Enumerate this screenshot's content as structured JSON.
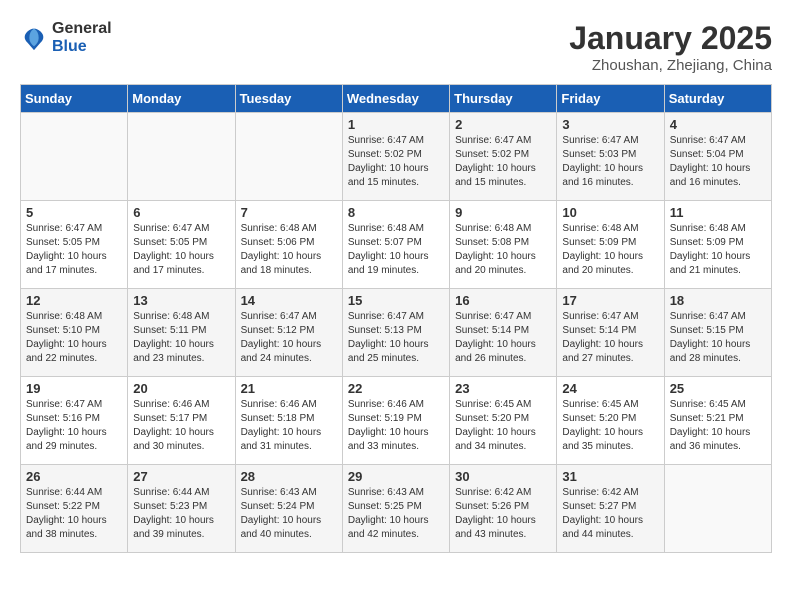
{
  "header": {
    "logo_line1": "General",
    "logo_line2": "Blue",
    "month": "January 2025",
    "location": "Zhoushan, Zhejiang, China"
  },
  "weekdays": [
    "Sunday",
    "Monday",
    "Tuesday",
    "Wednesday",
    "Thursday",
    "Friday",
    "Saturday"
  ],
  "weeks": [
    [
      {
        "day": "",
        "sunrise": "",
        "sunset": "",
        "daylight": ""
      },
      {
        "day": "",
        "sunrise": "",
        "sunset": "",
        "daylight": ""
      },
      {
        "day": "",
        "sunrise": "",
        "sunset": "",
        "daylight": ""
      },
      {
        "day": "1",
        "sunrise": "Sunrise: 6:47 AM",
        "sunset": "Sunset: 5:02 PM",
        "daylight": "Daylight: 10 hours and 15 minutes."
      },
      {
        "day": "2",
        "sunrise": "Sunrise: 6:47 AM",
        "sunset": "Sunset: 5:02 PM",
        "daylight": "Daylight: 10 hours and 15 minutes."
      },
      {
        "day": "3",
        "sunrise": "Sunrise: 6:47 AM",
        "sunset": "Sunset: 5:03 PM",
        "daylight": "Daylight: 10 hours and 16 minutes."
      },
      {
        "day": "4",
        "sunrise": "Sunrise: 6:47 AM",
        "sunset": "Sunset: 5:04 PM",
        "daylight": "Daylight: 10 hours and 16 minutes."
      }
    ],
    [
      {
        "day": "5",
        "sunrise": "Sunrise: 6:47 AM",
        "sunset": "Sunset: 5:05 PM",
        "daylight": "Daylight: 10 hours and 17 minutes."
      },
      {
        "day": "6",
        "sunrise": "Sunrise: 6:47 AM",
        "sunset": "Sunset: 5:05 PM",
        "daylight": "Daylight: 10 hours and 17 minutes."
      },
      {
        "day": "7",
        "sunrise": "Sunrise: 6:48 AM",
        "sunset": "Sunset: 5:06 PM",
        "daylight": "Daylight: 10 hours and 18 minutes."
      },
      {
        "day": "8",
        "sunrise": "Sunrise: 6:48 AM",
        "sunset": "Sunset: 5:07 PM",
        "daylight": "Daylight: 10 hours and 19 minutes."
      },
      {
        "day": "9",
        "sunrise": "Sunrise: 6:48 AM",
        "sunset": "Sunset: 5:08 PM",
        "daylight": "Daylight: 10 hours and 20 minutes."
      },
      {
        "day": "10",
        "sunrise": "Sunrise: 6:48 AM",
        "sunset": "Sunset: 5:09 PM",
        "daylight": "Daylight: 10 hours and 20 minutes."
      },
      {
        "day": "11",
        "sunrise": "Sunrise: 6:48 AM",
        "sunset": "Sunset: 5:09 PM",
        "daylight": "Daylight: 10 hours and 21 minutes."
      }
    ],
    [
      {
        "day": "12",
        "sunrise": "Sunrise: 6:48 AM",
        "sunset": "Sunset: 5:10 PM",
        "daylight": "Daylight: 10 hours and 22 minutes."
      },
      {
        "day": "13",
        "sunrise": "Sunrise: 6:48 AM",
        "sunset": "Sunset: 5:11 PM",
        "daylight": "Daylight: 10 hours and 23 minutes."
      },
      {
        "day": "14",
        "sunrise": "Sunrise: 6:47 AM",
        "sunset": "Sunset: 5:12 PM",
        "daylight": "Daylight: 10 hours and 24 minutes."
      },
      {
        "day": "15",
        "sunrise": "Sunrise: 6:47 AM",
        "sunset": "Sunset: 5:13 PM",
        "daylight": "Daylight: 10 hours and 25 minutes."
      },
      {
        "day": "16",
        "sunrise": "Sunrise: 6:47 AM",
        "sunset": "Sunset: 5:14 PM",
        "daylight": "Daylight: 10 hours and 26 minutes."
      },
      {
        "day": "17",
        "sunrise": "Sunrise: 6:47 AM",
        "sunset": "Sunset: 5:14 PM",
        "daylight": "Daylight: 10 hours and 27 minutes."
      },
      {
        "day": "18",
        "sunrise": "Sunrise: 6:47 AM",
        "sunset": "Sunset: 5:15 PM",
        "daylight": "Daylight: 10 hours and 28 minutes."
      }
    ],
    [
      {
        "day": "19",
        "sunrise": "Sunrise: 6:47 AM",
        "sunset": "Sunset: 5:16 PM",
        "daylight": "Daylight: 10 hours and 29 minutes."
      },
      {
        "day": "20",
        "sunrise": "Sunrise: 6:46 AM",
        "sunset": "Sunset: 5:17 PM",
        "daylight": "Daylight: 10 hours and 30 minutes."
      },
      {
        "day": "21",
        "sunrise": "Sunrise: 6:46 AM",
        "sunset": "Sunset: 5:18 PM",
        "daylight": "Daylight: 10 hours and 31 minutes."
      },
      {
        "day": "22",
        "sunrise": "Sunrise: 6:46 AM",
        "sunset": "Sunset: 5:19 PM",
        "daylight": "Daylight: 10 hours and 33 minutes."
      },
      {
        "day": "23",
        "sunrise": "Sunrise: 6:45 AM",
        "sunset": "Sunset: 5:20 PM",
        "daylight": "Daylight: 10 hours and 34 minutes."
      },
      {
        "day": "24",
        "sunrise": "Sunrise: 6:45 AM",
        "sunset": "Sunset: 5:20 PM",
        "daylight": "Daylight: 10 hours and 35 minutes."
      },
      {
        "day": "25",
        "sunrise": "Sunrise: 6:45 AM",
        "sunset": "Sunset: 5:21 PM",
        "daylight": "Daylight: 10 hours and 36 minutes."
      }
    ],
    [
      {
        "day": "26",
        "sunrise": "Sunrise: 6:44 AM",
        "sunset": "Sunset: 5:22 PM",
        "daylight": "Daylight: 10 hours and 38 minutes."
      },
      {
        "day": "27",
        "sunrise": "Sunrise: 6:44 AM",
        "sunset": "Sunset: 5:23 PM",
        "daylight": "Daylight: 10 hours and 39 minutes."
      },
      {
        "day": "28",
        "sunrise": "Sunrise: 6:43 AM",
        "sunset": "Sunset: 5:24 PM",
        "daylight": "Daylight: 10 hours and 40 minutes."
      },
      {
        "day": "29",
        "sunrise": "Sunrise: 6:43 AM",
        "sunset": "Sunset: 5:25 PM",
        "daylight": "Daylight: 10 hours and 42 minutes."
      },
      {
        "day": "30",
        "sunrise": "Sunrise: 6:42 AM",
        "sunset": "Sunset: 5:26 PM",
        "daylight": "Daylight: 10 hours and 43 minutes."
      },
      {
        "day": "31",
        "sunrise": "Sunrise: 6:42 AM",
        "sunset": "Sunset: 5:27 PM",
        "daylight": "Daylight: 10 hours and 44 minutes."
      },
      {
        "day": "",
        "sunrise": "",
        "sunset": "",
        "daylight": ""
      }
    ]
  ]
}
